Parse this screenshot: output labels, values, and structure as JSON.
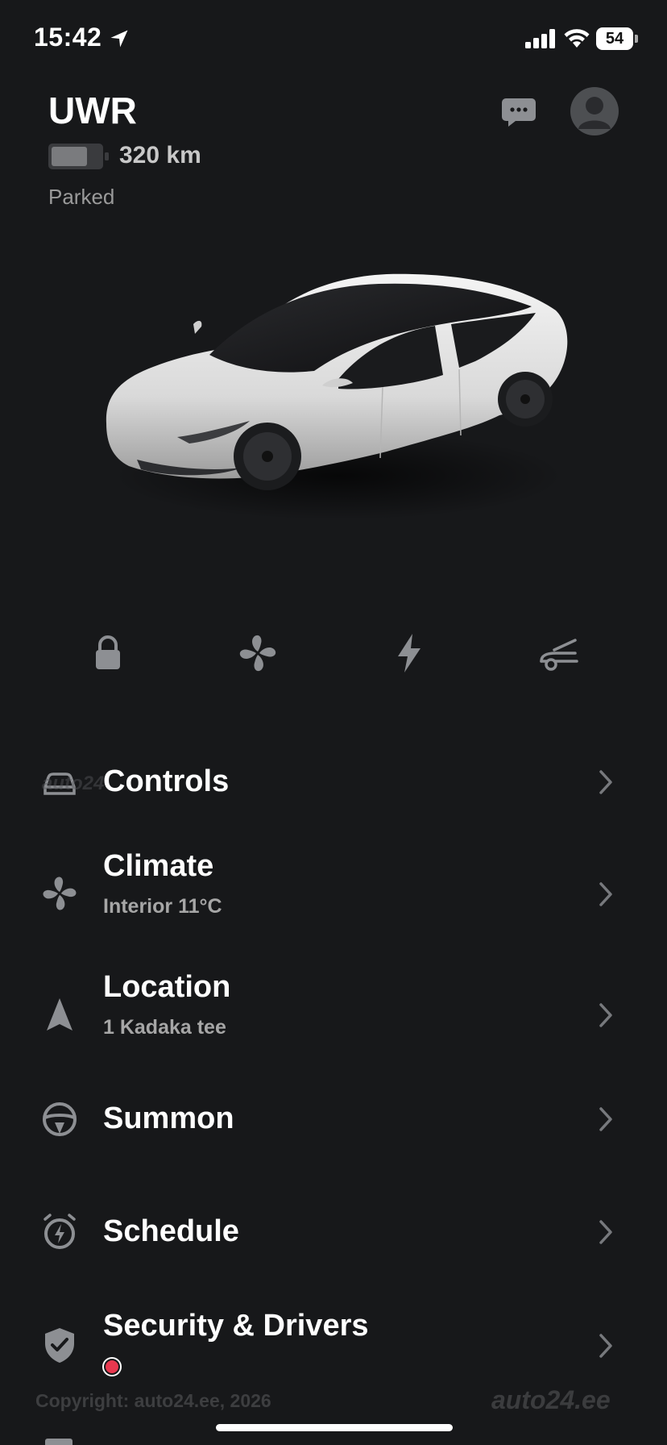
{
  "status_bar": {
    "time": "15:42",
    "battery_percent": "54"
  },
  "vehicle": {
    "name": "UWR",
    "range": "320 km",
    "status": "Parked"
  },
  "quick_actions": [
    {
      "icon": "lock-icon"
    },
    {
      "icon": "fan-icon"
    },
    {
      "icon": "bolt-icon"
    },
    {
      "icon": "trunk-icon"
    }
  ],
  "menu": {
    "controls": {
      "title": "Controls",
      "icon": "car-icon"
    },
    "climate": {
      "title": "Climate",
      "subtitle": "Interior 11°C",
      "icon": "fan-icon"
    },
    "location": {
      "title": "Location",
      "subtitle": "1 Kadaka tee",
      "icon": "navigation-arrow-icon"
    },
    "summon": {
      "title": "Summon",
      "icon": "steering-wheel-icon"
    },
    "schedule": {
      "title": "Schedule",
      "icon": "alarm-bolt-icon"
    },
    "security": {
      "title": "Security & Drivers",
      "icon": "shield-check-icon",
      "badge_color": "#e8384f"
    }
  },
  "watermark": {
    "copyright": "Copyright: auto24.ee, 2026",
    "brand": "auto24.ee",
    "overlay": "auto24"
  },
  "colors": {
    "background": "#17181a",
    "text": "#ffffff",
    "muted": "#9a9a9a",
    "icon": "#8d8f93"
  }
}
